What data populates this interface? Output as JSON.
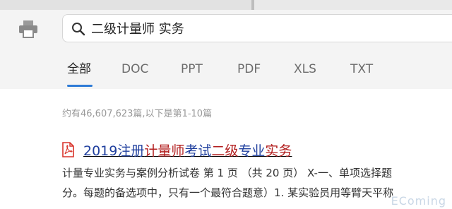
{
  "search": {
    "query": "二级计量师 实务"
  },
  "tabs": [
    {
      "label": "全部",
      "active": true
    },
    {
      "label": "DOC"
    },
    {
      "label": "PPT"
    },
    {
      "label": "PDF"
    },
    {
      "label": "XLS"
    },
    {
      "label": "TXT"
    }
  ],
  "results": {
    "count_text": "约有46,607,623篇,以下是第1-10篇",
    "first": {
      "file_icon": "pdf-icon",
      "title_parts": [
        "2019注册",
        "计量师",
        "考试",
        "二级",
        "专业",
        "实务"
      ],
      "snippet_line1": "计量专业实务与案例分析试卷 第 1 页 （共 20 页） X-一、单项选择题",
      "snippet_line2": "分。每题的备选项中，只有一个最符合题意）1. 某实验员用等臂天平称"
    }
  },
  "colors": {
    "accent": "#2e7bd6",
    "link": "#1f3f9e",
    "highlight": "#b21d1d"
  },
  "watermark": "EComing"
}
